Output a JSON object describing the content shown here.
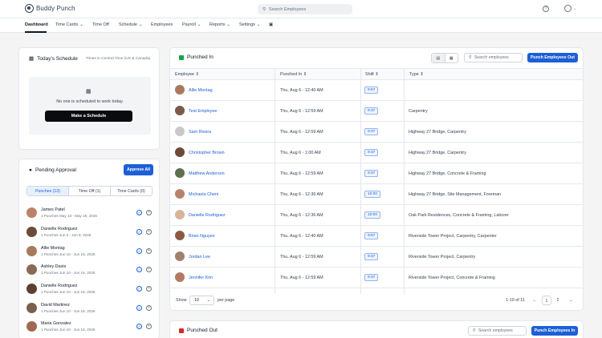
{
  "app": {
    "brand": "Buddy Punch",
    "search_placeholder": "Search Employees"
  },
  "nav": {
    "items": [
      {
        "label": "Dashboard",
        "active": true
      },
      {
        "label": "Time Cards",
        "dropdown": true
      },
      {
        "label": "Time Off"
      },
      {
        "label": "Schedule",
        "dropdown": true
      },
      {
        "label": "Employees"
      },
      {
        "label": "Payroll",
        "dropdown": true
      },
      {
        "label": "Reports",
        "dropdown": true
      },
      {
        "label": "Settings",
        "dropdown": true
      }
    ]
  },
  "schedule": {
    "title": "Today's Schedule",
    "timezone": "Times in Central Time (US & Canada)",
    "empty_text": "No one is scheduled to work today.",
    "button": "Make a Schedule"
  },
  "pending": {
    "title": "Pending Approval",
    "approve_all": "Approve All",
    "tabs": [
      "Punches (13)",
      "Time Off (1)",
      "Time Cards (0)"
    ],
    "rows": [
      {
        "name": "James Patel",
        "sub": "1 Punches May 13 - May 19, 2026"
      },
      {
        "name": "Danielle Rodriguez",
        "sub": "1 Punches Jun 3 - Jun 9, 2026"
      },
      {
        "name": "Allie Montag",
        "sub": "1 Punches Jun 10 - Jun 16, 2026"
      },
      {
        "name": "Ashley Davis",
        "sub": "1 Punches Jun 10 - Jun 16, 2026"
      },
      {
        "name": "Danielle Rodriguez",
        "sub": "1 Punches Jun 10 - Jun 16, 2026"
      },
      {
        "name": "David Martinez",
        "sub": "1 Punches Jun 10 - Jun 16, 2026"
      },
      {
        "name": "Maria Gonzalez",
        "sub": "1 Punches Jun 10 - Jun 16, 2026"
      }
    ]
  },
  "punched_in": {
    "title": "Punched In",
    "search_placeholder": "Search employees",
    "button": "Punch Employees Out",
    "headers": [
      "Employee",
      "Punched In",
      "Shift",
      "Type"
    ],
    "rows": [
      {
        "employee": "Allie Montag",
        "punched_in": "Thu, Aug 6 - 12:40 AM",
        "shift": "9:57",
        "type": ""
      },
      {
        "employee": "Test Employee",
        "punched_in": "Thu, Aug 6 - 12:59 AM",
        "shift": "9:37",
        "type": "Carpentry"
      },
      {
        "employee": "Sam Rivera",
        "punched_in": "Thu, Aug 6 - 12:59 AM",
        "shift": "9:37",
        "type": "Highway 27 Bridge, Carpentry"
      },
      {
        "employee": "Christopher Brown",
        "punched_in": "Thu, Aug 6 - 1:00 AM",
        "shift": "9:37",
        "type": "Highway 27 Bridge, Carpentry"
      },
      {
        "employee": "Matthew Anderson",
        "punched_in": "Thu, Aug 6 - 12:59 AM",
        "shift": "9:37",
        "type": "Highway 27 Bridge, Concrete & Framing"
      },
      {
        "employee": "Michaela Cheni",
        "punched_in": "Thu, Aug 6 - 12:36 AM",
        "shift": "10:00",
        "type": "Highway 27 Bridge, Site Management, Foreman"
      },
      {
        "employee": "Danielle Rodriguez",
        "punched_in": "Thu, Aug 6 - 12:36 AM",
        "shift": "10:00",
        "type": "Oak Park Residences, Concrete & Framing, Laborer"
      },
      {
        "employee": "Brian Nguyen",
        "punched_in": "Thu, Aug 6 - 12:40 AM",
        "shift": "9:57",
        "type": "Riverside Tower Project, Carpentry, Carpenter"
      },
      {
        "employee": "Jordan Lee",
        "punched_in": "Thu, Aug 6 - 12:59 AM",
        "shift": "9:37",
        "type": "Riverside Tower Project, Carpentry"
      },
      {
        "employee": "Jennifer Kim",
        "punched_in": "Thu, Aug 6 - 12:59 AM",
        "shift": "9:37",
        "type": "Riverside Tower Project, Concrete & Framing"
      }
    ],
    "footer": {
      "show": "Show",
      "per_page_value": "10",
      "per_page": "per page",
      "range": "1-10 of 11",
      "pages": [
        "1",
        "2"
      ]
    }
  },
  "punched_out": {
    "title": "Punched Out",
    "search_placeholder": "Search employees",
    "button": "Punch Employees In"
  },
  "colors": {
    "accent": "#1d5fd6",
    "dark_button": "#0b0b0f"
  }
}
